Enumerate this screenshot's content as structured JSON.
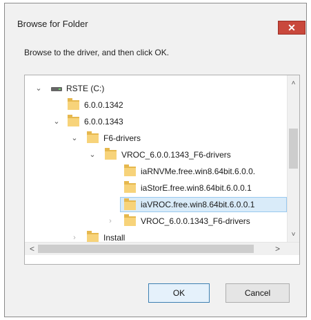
{
  "window": {
    "title": "Browse for Folder",
    "close_glyph": "✕"
  },
  "instructions": "Browse to the driver, and then click OK.",
  "tree": {
    "items": [
      {
        "label": "RSTE (C:)",
        "icon": "drive-icon",
        "expanded": true
      },
      {
        "label": "6.0.0.1342",
        "icon": "folder-icon"
      },
      {
        "label": "6.0.0.1343",
        "icon": "folder-icon",
        "expanded": true
      },
      {
        "label": "F6-drivers",
        "icon": "folder-icon",
        "expanded": true
      },
      {
        "label": "VROC_6.0.0.1343_F6-drivers",
        "icon": "folder-icon",
        "expanded": true
      },
      {
        "label": "iaRNVMe.free.win8.64bit.6.0.0.",
        "icon": "folder-icon"
      },
      {
        "label": "iaStorE.free.win8.64bit.6.0.0.1",
        "icon": "folder-icon"
      },
      {
        "label": "iaVROC.free.win8.64bit.6.0.0.1",
        "icon": "folder-icon",
        "selected": true
      },
      {
        "label": "VROC_6.0.0.1343_F6-drivers",
        "icon": "folder-icon",
        "expanded": false
      },
      {
        "label": "Install",
        "icon": "folder-icon",
        "expanded": false
      }
    ]
  },
  "scrollbars": {
    "up_glyph": "˄",
    "down_glyph": "˅",
    "left_glyph": "<",
    "right_glyph": ">"
  },
  "buttons": {
    "ok": "OK",
    "cancel": "Cancel"
  },
  "colors": {
    "close_button": "#c9483c",
    "selection": "#d9ebf9",
    "folder": "#f7d37a"
  }
}
